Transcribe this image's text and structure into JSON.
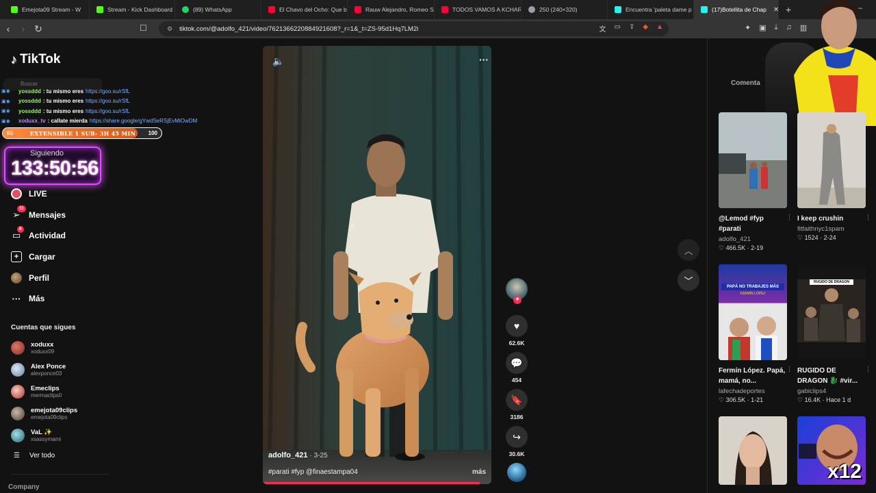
{
  "browser": {
    "tabs": [
      {
        "label": "Emejota09 Stream - W",
        "color": "#53fc18"
      },
      {
        "label": "Stream - Kick Dashboard",
        "color": "#53fc18"
      },
      {
        "label": "(89) WhatsApp",
        "color": "#25d366"
      },
      {
        "label": "El Chavo del Ocho: Que bu",
        "color": "#ff0033"
      },
      {
        "label": "Rauw Alejandro, Romeo Sa",
        "color": "#ff0033"
      },
      {
        "label": "TODOS VAMOS A KCHAR",
        "color": "#ff0033"
      },
      {
        "label": "250 (240×320)",
        "color": "#9aa0a6"
      },
      {
        "label": "Encuentra 'paleta dame p",
        "color": "#25f4ee"
      },
      {
        "label": "(17)Botellita de Chap",
        "color": "#25f4ee",
        "active": true
      }
    ],
    "url": "tiktok.com/@adolfo_421/video/7621366220884921608?_r=1&_t=ZS-95d1Hq7LM2i"
  },
  "sidebar": {
    "logo": "TikTok",
    "search_placeholder": "Buscar",
    "nav": {
      "live": "LIVE",
      "mensajes": "Mensajes",
      "mensajes_badge": "11",
      "actividad": "Actividad",
      "actividad_badge": "6",
      "cargar": "Cargar",
      "perfil": "Perfil",
      "mas": "Más"
    },
    "following_title": "Cuentas que sigues",
    "following": [
      {
        "name": "xoduxx",
        "handle": "xoduxx09",
        "color": "#b04a3a"
      },
      {
        "name": "Alex Ponce",
        "handle": "alexponce03",
        "color": "#8aa7c9"
      },
      {
        "name": "Emeclips",
        "handle": "mermaclips0",
        "color": "#c84848"
      },
      {
        "name": "emejota09clips",
        "handle": "emejota09clips",
        "color": "#6a5a4a"
      },
      {
        "name": "VaL ✨",
        "handle": "xsassymami",
        "color": "#3d7f8c"
      }
    ],
    "ver_todo": "Ver todo",
    "company": "Company"
  },
  "overlay": {
    "chat": [
      {
        "user": "yossddd",
        "msg": ": tu mismo eres",
        "link": "https://goo.su/rSfL"
      },
      {
        "user": "yossddd",
        "msg": ": tu mismo eres",
        "link": "https://goo.su/rSfL"
      },
      {
        "user": "yossddd",
        "msg": ": tu mismo eres",
        "link": "https://goo.su/rSfL"
      },
      {
        "user": "xoduxx_tv",
        "msg": ": callate mierda",
        "link": "https://share.google/gYwdSeRSjEvMiOwDM"
      }
    ],
    "subathon": {
      "left": "85",
      "label": "EXTENSIBLE 1 SUB- 3H 45 MIN",
      "right": "100",
      "progress": 0.85
    },
    "timer_label": "Siguiendo",
    "timer": "133:50:56"
  },
  "video": {
    "author": "adolfo_421",
    "date": "· 3-25",
    "caption": "#parati #fyp @finaestampa04",
    "more": "más",
    "progress": 0.95
  },
  "actions": {
    "likes": "62.6K",
    "comments": "454",
    "saves": "3186",
    "shares": "30.6K"
  },
  "right_panel": {
    "tab_label": "Comenta",
    "cards": [
      {
        "title": "@Lemod #fyp #parati",
        "author": "adolfo_421",
        "stats": "♡ 466.5K · 2-19"
      },
      {
        "title": "I keep crushin",
        "author": "fitfaithnyc1spam",
        "stats": "♡ 1524 · 2-24"
      },
      {
        "title": "Fermín López. Papá, mamá, no...",
        "author": "lafechadeportes",
        "stats": "♡ 306.5K · 1-21"
      },
      {
        "title": "RUGIDO DE DRAGON 🐉 #vir...",
        "author": "gabiclips4",
        "stats": "♡ 16.4K · Hace 1 d"
      },
      {
        "title": "",
        "author": "",
        "stats": ""
      },
      {
        "title": "",
        "author": "",
        "stats": ""
      }
    ],
    "thumb_text_3": "PAPÁ NO TRABAJES MÁS",
    "thumb_sub_3": "FERMÍN LÓPEZ",
    "thumb_text_4": "RUGIDO DE DRAGON",
    "thumb_text_6": "x12"
  }
}
